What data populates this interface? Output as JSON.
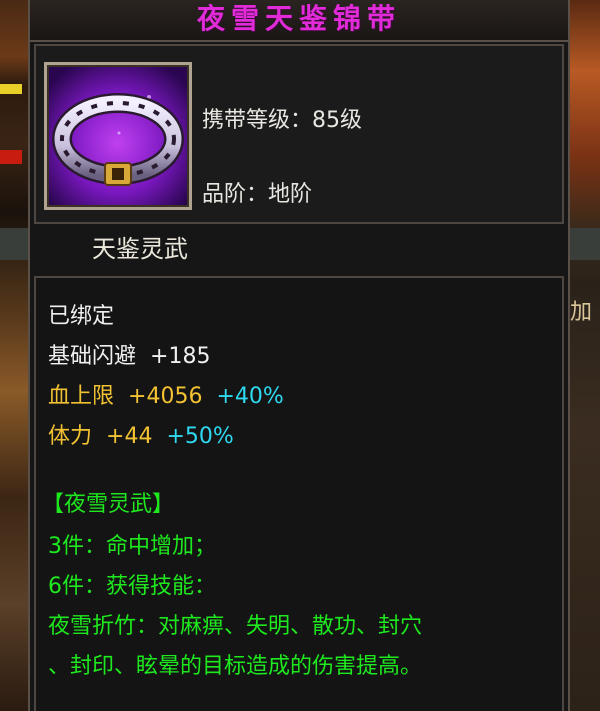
{
  "item": {
    "name": "夜雪天鉴锦带",
    "level_label": "携带等级：85级",
    "grade_label": "品阶：地阶",
    "set_series": "天鉴灵武",
    "icon": "purple-belt-icon"
  },
  "stats": {
    "bound": "已绑定",
    "dodge_label": "基础闪避",
    "dodge_value": "+185",
    "hp_label": "血上限",
    "hp_value": "+4056",
    "hp_bonus": "+40%",
    "stamina_label": "体力",
    "stamina_value": "+44",
    "stamina_bonus": "+50%"
  },
  "set_bonus": {
    "title": "【夜雪灵武】",
    "piece3": "3件：命中增加；",
    "piece6": "6件：获得技能：",
    "skill_line1": "夜雪折竹：对麻痹、失明、散功、封穴",
    "skill_line2": "、封印、眩晕的目标造成的伤害提高。"
  },
  "background": {
    "side_text": "加"
  },
  "colors": {
    "title": "#e12ad8",
    "stat_gold": "#f2c232",
    "bonus_cyan": "#2ed8f0",
    "set_green": "#1ee81e",
    "text_white": "#f0f0f0"
  }
}
